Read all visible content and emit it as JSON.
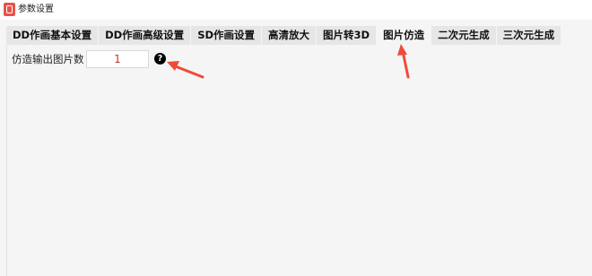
{
  "window": {
    "title": "参数设置"
  },
  "tabs": [
    {
      "label": "DD作画基本设置",
      "active": false
    },
    {
      "label": "DD作画高级设置",
      "active": false
    },
    {
      "label": "SD作画设置",
      "active": false
    },
    {
      "label": "高清放大",
      "active": false
    },
    {
      "label": "图片转3D",
      "active": false
    },
    {
      "label": "图片仿造",
      "active": true
    },
    {
      "label": "二次元生成",
      "active": false
    },
    {
      "label": "三次元生成",
      "active": false
    }
  ],
  "form": {
    "label": "仿造输出图片数",
    "value": "1",
    "help_icon": "question-circle-icon"
  },
  "colors": {
    "annotation_arrow": "#f04b3a",
    "input_text": "#c0392b"
  }
}
